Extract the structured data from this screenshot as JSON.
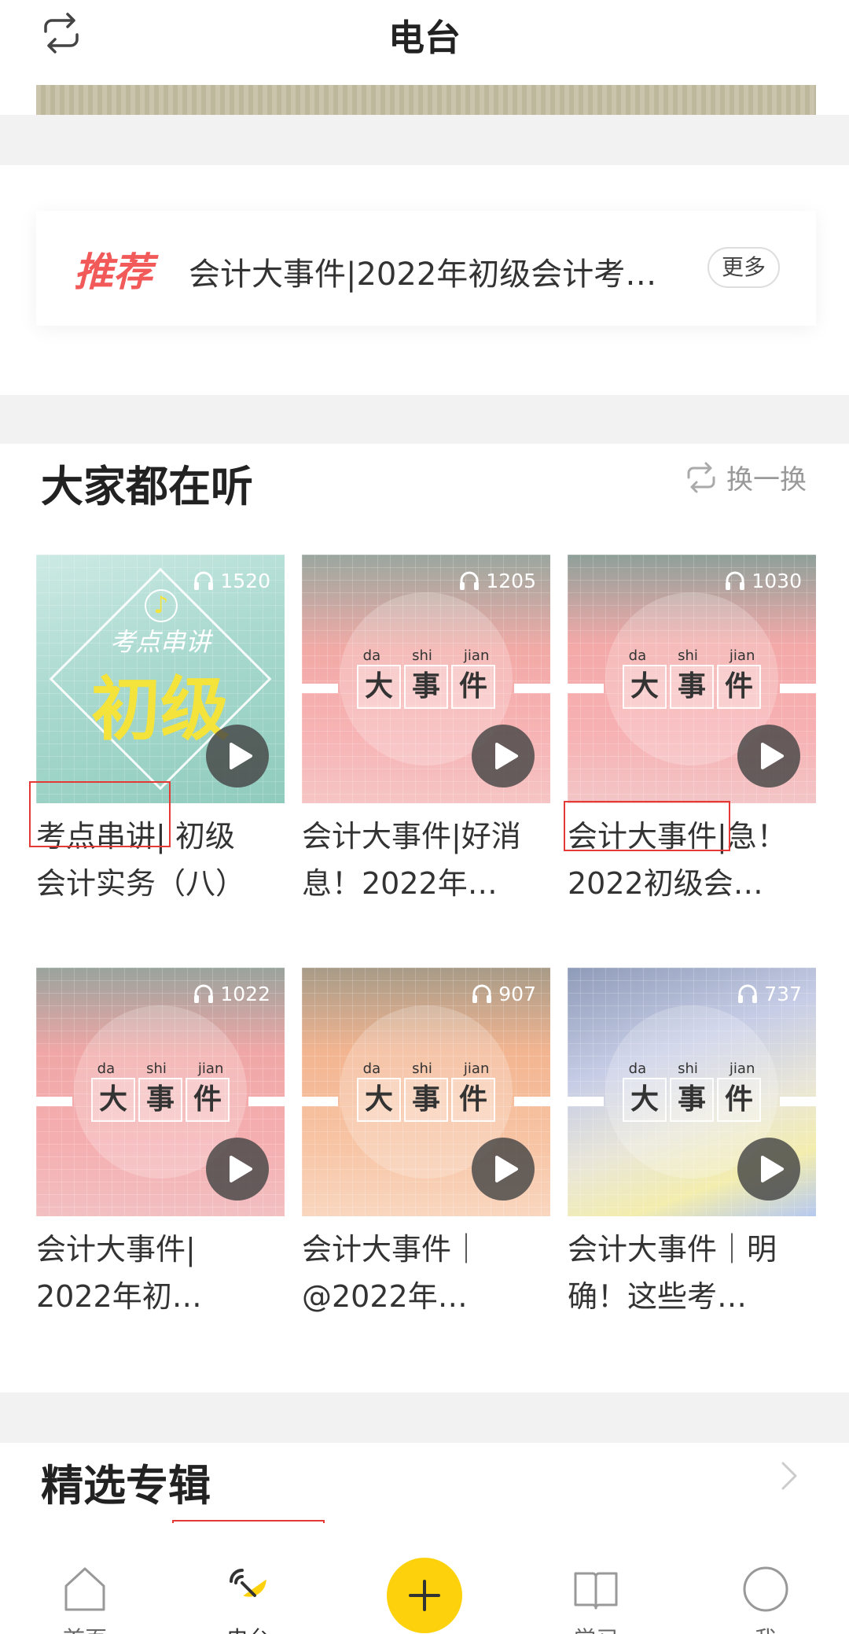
{
  "header": {
    "title": "电台",
    "refresh_icon": "refresh-icon"
  },
  "recommend": {
    "tag": "推荐",
    "text": "会计大事件|2022年初级会计考…",
    "more_label": "更多"
  },
  "popular": {
    "title": "大家都在听",
    "swap_label": "换一换",
    "items": [
      {
        "count": "1520",
        "cover": {
          "subtitle": "考点串讲",
          "title": "初级"
        },
        "name_lines": [
          "考点串讲| 初级",
          "会计实务（八）"
        ]
      },
      {
        "count": "1205",
        "cover": {
          "pinyin": [
            "da",
            "shi",
            "jian"
          ],
          "chars": [
            "大",
            "事",
            "件"
          ]
        },
        "name_lines": [
          "会计大事件|好消",
          "息！2022年…"
        ]
      },
      {
        "count": "1030",
        "cover": {
          "pinyin": [
            "da",
            "shi",
            "jian"
          ],
          "chars": [
            "大",
            "事",
            "件"
          ]
        },
        "name_lines": [
          "会计大事件|急！",
          "2022初级会…"
        ]
      },
      {
        "count": "1022",
        "cover": {
          "pinyin": [
            "da",
            "shi",
            "jian"
          ],
          "chars": [
            "大",
            "事",
            "件"
          ]
        },
        "name_lines": [
          "会计大事件|",
          "2022年初…"
        ]
      },
      {
        "count": "907",
        "cover": {
          "pinyin": [
            "da",
            "shi",
            "jian"
          ],
          "chars": [
            "大",
            "事",
            "件"
          ]
        },
        "name_lines": [
          "会计大事件｜",
          "@2022年…"
        ]
      },
      {
        "count": "737",
        "cover": {
          "pinyin": [
            "da",
            "shi",
            "jian"
          ],
          "chars": [
            "大",
            "事",
            "件"
          ]
        },
        "name_lines": [
          "会计大事件｜明",
          "确！这些考…"
        ]
      }
    ]
  },
  "featured": {
    "title": "精选专辑"
  },
  "nav": {
    "items": [
      {
        "label": "首页",
        "icon": "home-icon"
      },
      {
        "label": "电台",
        "icon": "radio-icon",
        "active": true
      },
      {
        "label": "",
        "icon": "plus-icon"
      },
      {
        "label": "学习",
        "icon": "book-icon"
      },
      {
        "label": "我",
        "icon": "profile-icon"
      }
    ]
  },
  "colors": {
    "accent_yellow": "#fdd20c",
    "recommend_red": "#f25a5a",
    "highlight_red": "#e53935"
  }
}
